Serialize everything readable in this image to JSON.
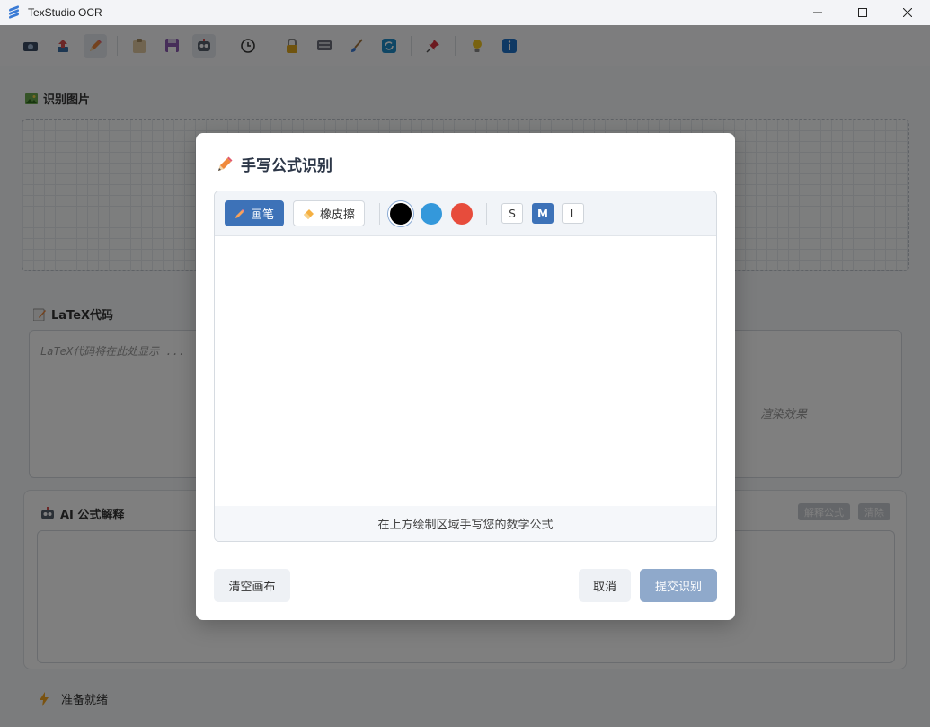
{
  "window": {
    "title": "TexStudio OCR",
    "minimize": "—",
    "maximize": "☐",
    "close": "✕"
  },
  "toolbar": {
    "icons": [
      "camera-icon",
      "upload-icon",
      "pencil-icon",
      "clipboard-icon",
      "save-icon",
      "robot-icon",
      "clock-icon",
      "lock-icon",
      "keyboard-icon",
      "brush-icon",
      "refresh-icon",
      "pin-icon",
      "bulb-icon",
      "info-icon"
    ]
  },
  "main": {
    "image_section_title": "识别图片",
    "latex_section_title": "LaTeX代码",
    "latex_placeholder": "LaTeX代码将在此处显示 ...",
    "render_placeholder": "渲染效果",
    "ai_section_title": "AI 公式解释",
    "ai_explain_button": "解释公式",
    "ai_clear_button": "清除",
    "status_text": "准备就绪"
  },
  "modal": {
    "title": "手写公式识别",
    "tools": {
      "pen_label": "画笔",
      "eraser_label": "橡皮擦",
      "colors": [
        "#000000",
        "#3498db",
        "#e74c3c"
      ],
      "selected_color": "#000000",
      "sizes": [
        "S",
        "M",
        "L"
      ],
      "selected_size": "M"
    },
    "canvas_hint": "在上方绘制区域手写您的数学公式",
    "clear_button": "清空画布",
    "cancel_button": "取消",
    "submit_button": "提交识别"
  }
}
